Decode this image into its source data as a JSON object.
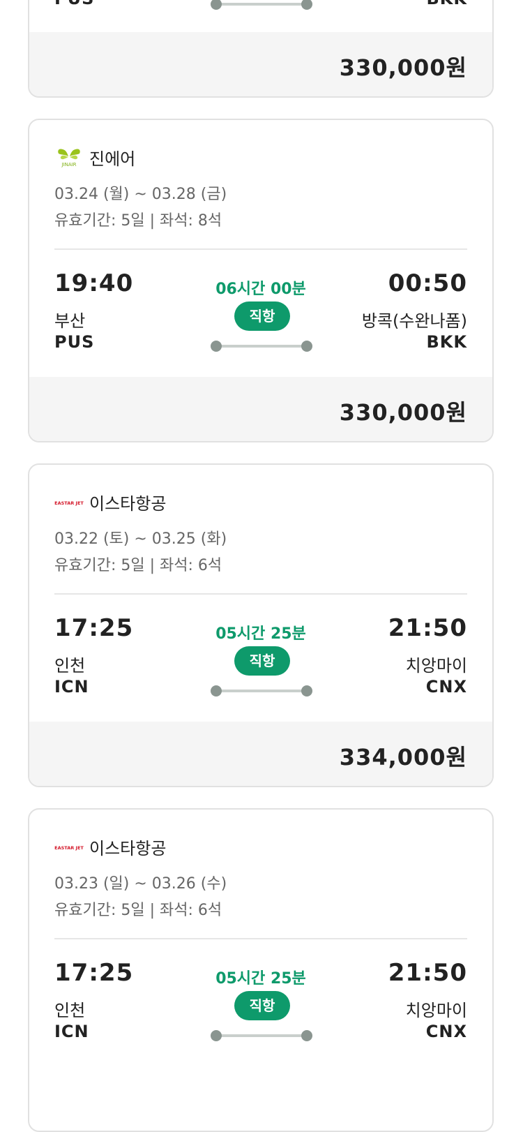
{
  "cards": [
    {
      "dep_code": "PUS",
      "arr_code": "BKK",
      "price": "330,000원"
    },
    {
      "airline": "진에어",
      "airline_logo": "jinair-logo",
      "dates": "03.24 (월) ~ 03.28 (금)",
      "validity": "유효기간: 5일 | 좌석: 8석",
      "dep_time": "19:40",
      "dep_city": "부산",
      "dep_code": "PUS",
      "duration": "06시간 00분",
      "direct": "직항",
      "arr_time": "00:50",
      "arr_city": "방콕(수완나폼)",
      "arr_code": "BKK",
      "price": "330,000원"
    },
    {
      "airline": "이스타항공",
      "airline_logo": "eastarjet-logo",
      "dates": "03.22 (토) ~ 03.25 (화)",
      "validity": "유효기간: 5일 | 좌석: 6석",
      "dep_time": "17:25",
      "dep_city": "인천",
      "dep_code": "ICN",
      "duration": "05시간 25분",
      "direct": "직항",
      "arr_time": "21:50",
      "arr_city": "치앙마이",
      "arr_code": "CNX",
      "price": "334,000원"
    },
    {
      "airline": "이스타항공",
      "airline_logo": "eastarjet-logo",
      "dates": "03.23 (일) ~ 03.26 (수)",
      "validity": "유효기간: 5일 | 좌석: 6석",
      "dep_time": "17:25",
      "dep_city": "인천",
      "dep_code": "ICN",
      "duration": "05시간 25분",
      "direct": "직항",
      "arr_time": "21:50",
      "arr_city": "치앙마이",
      "arr_code": "CNX"
    }
  ],
  "logos": {
    "jinair_text": "JINAIR",
    "eastar_text": "EASTAR JET"
  },
  "colors": {
    "accent": "#0e9a6b",
    "route_dot": "#8a9590",
    "card_border": "#e1e1e1",
    "price_bg": "#f5f5f5"
  }
}
